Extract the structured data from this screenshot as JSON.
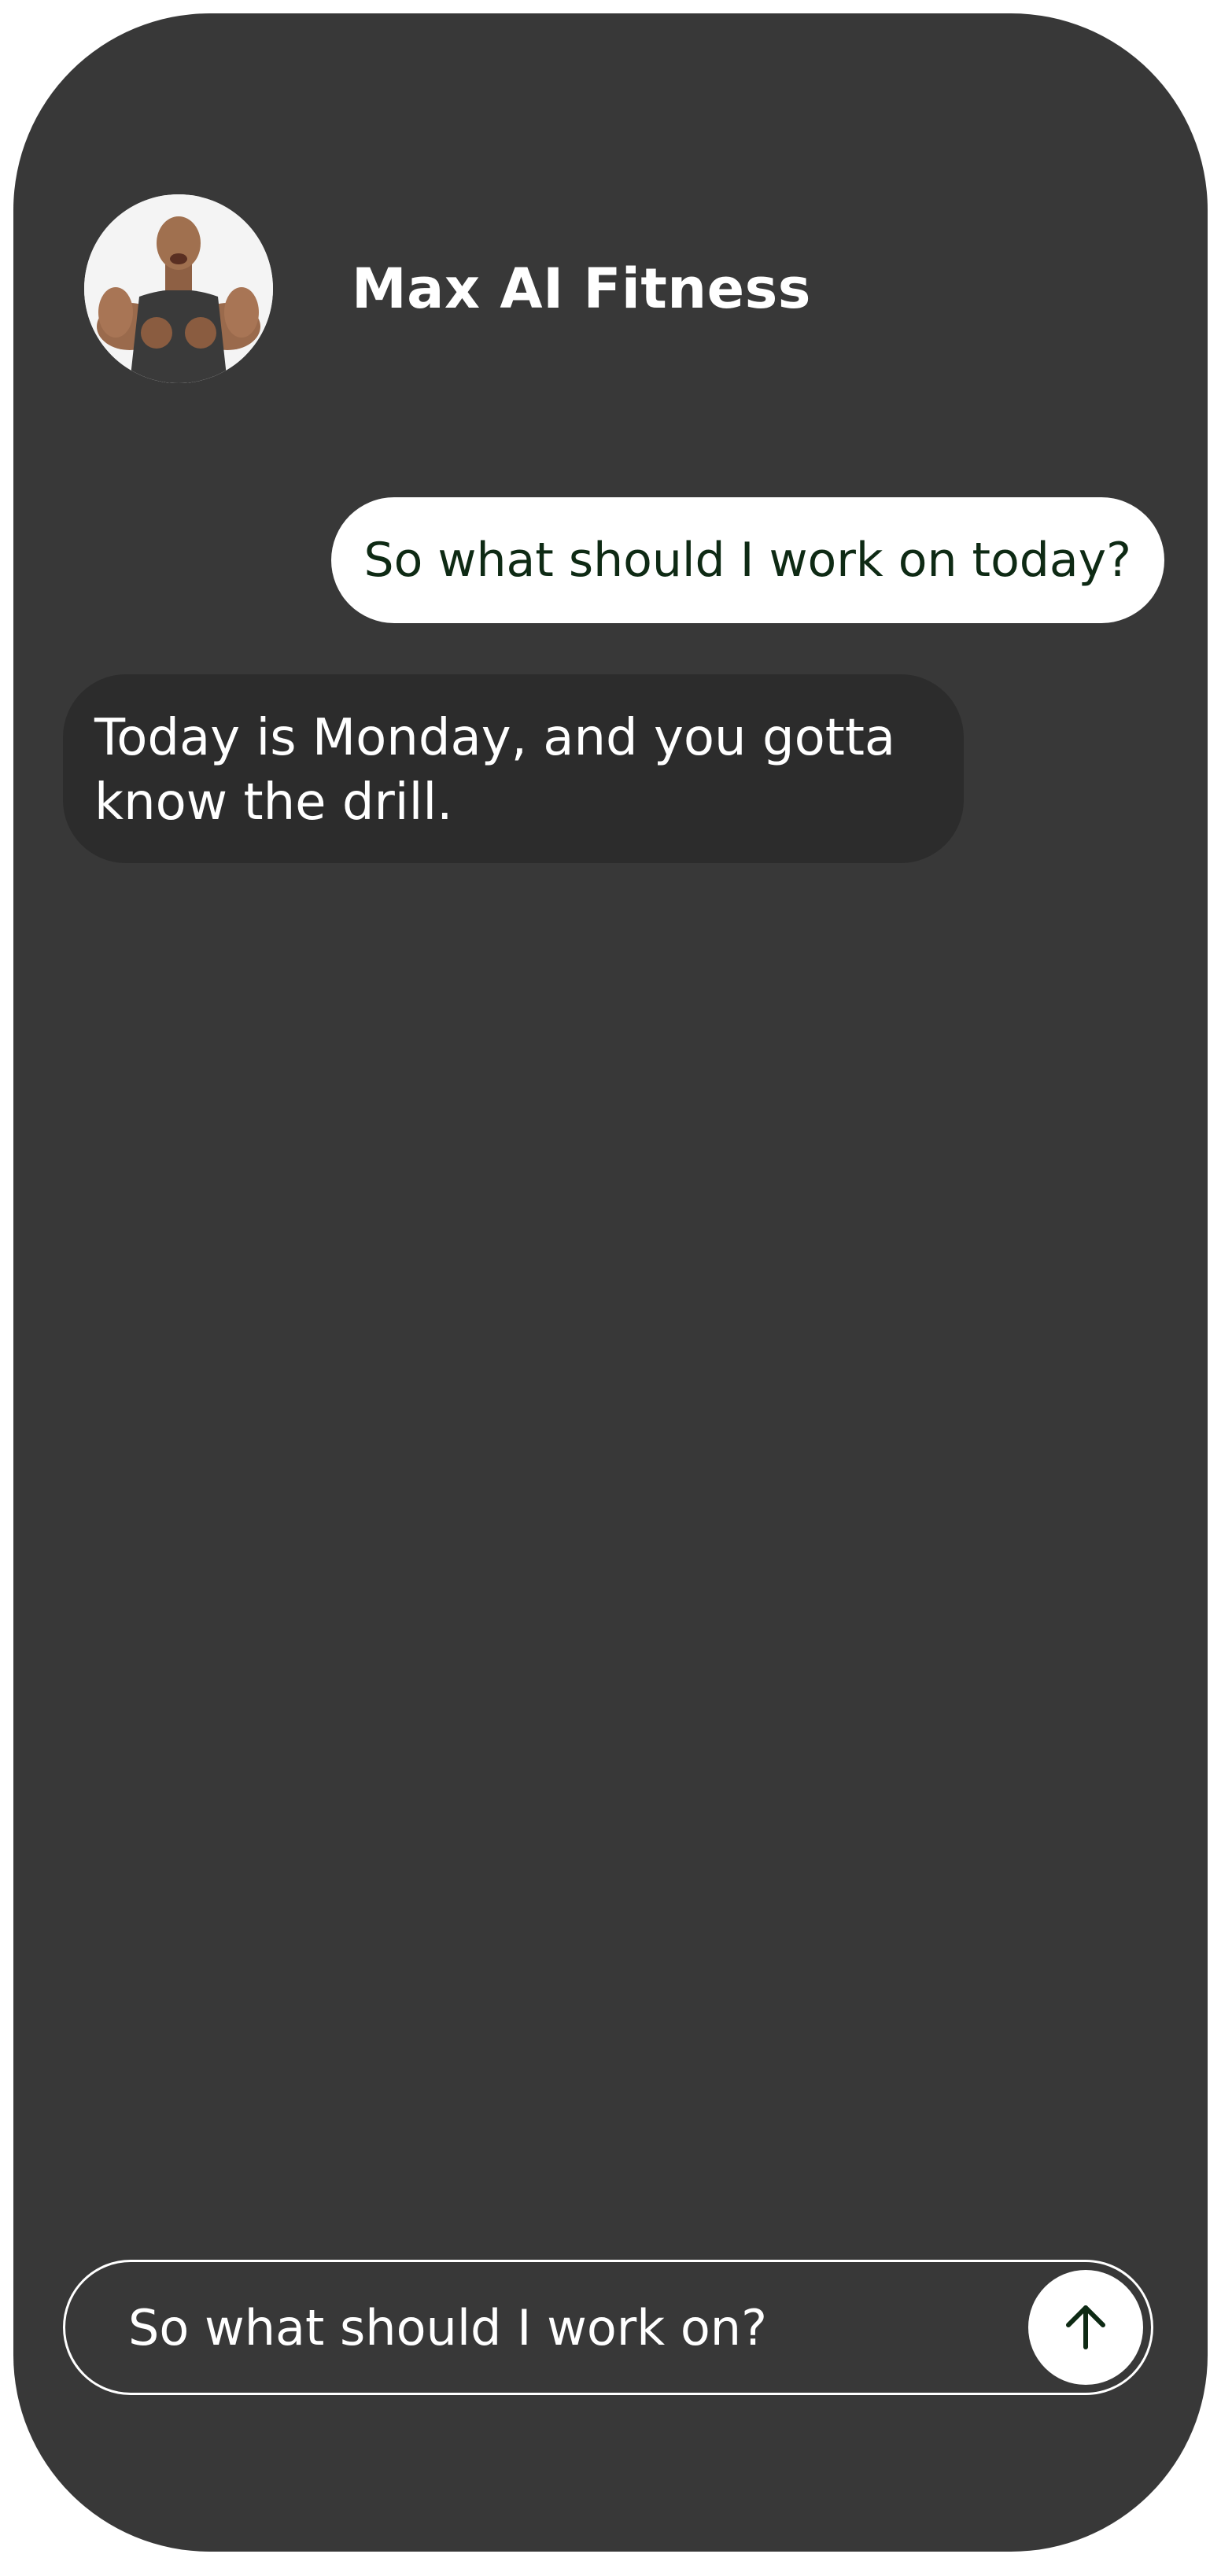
{
  "header": {
    "title": "Max AI Fitness",
    "avatar_icon": "trainer-avatar"
  },
  "messages": [
    {
      "role": "user",
      "text": "So what should I work on today?"
    },
    {
      "role": "assistant",
      "text": "Today is Monday, and you gotta know the drill."
    }
  ],
  "composer": {
    "value": "So what should I work on?",
    "send_icon": "arrow-up-icon"
  },
  "colors": {
    "background": "#383838",
    "user_bubble": "#ffffff",
    "user_text": "#0e2a14",
    "assistant_bubble": "#2c2c2c",
    "send_icon": "#0e2a14"
  }
}
